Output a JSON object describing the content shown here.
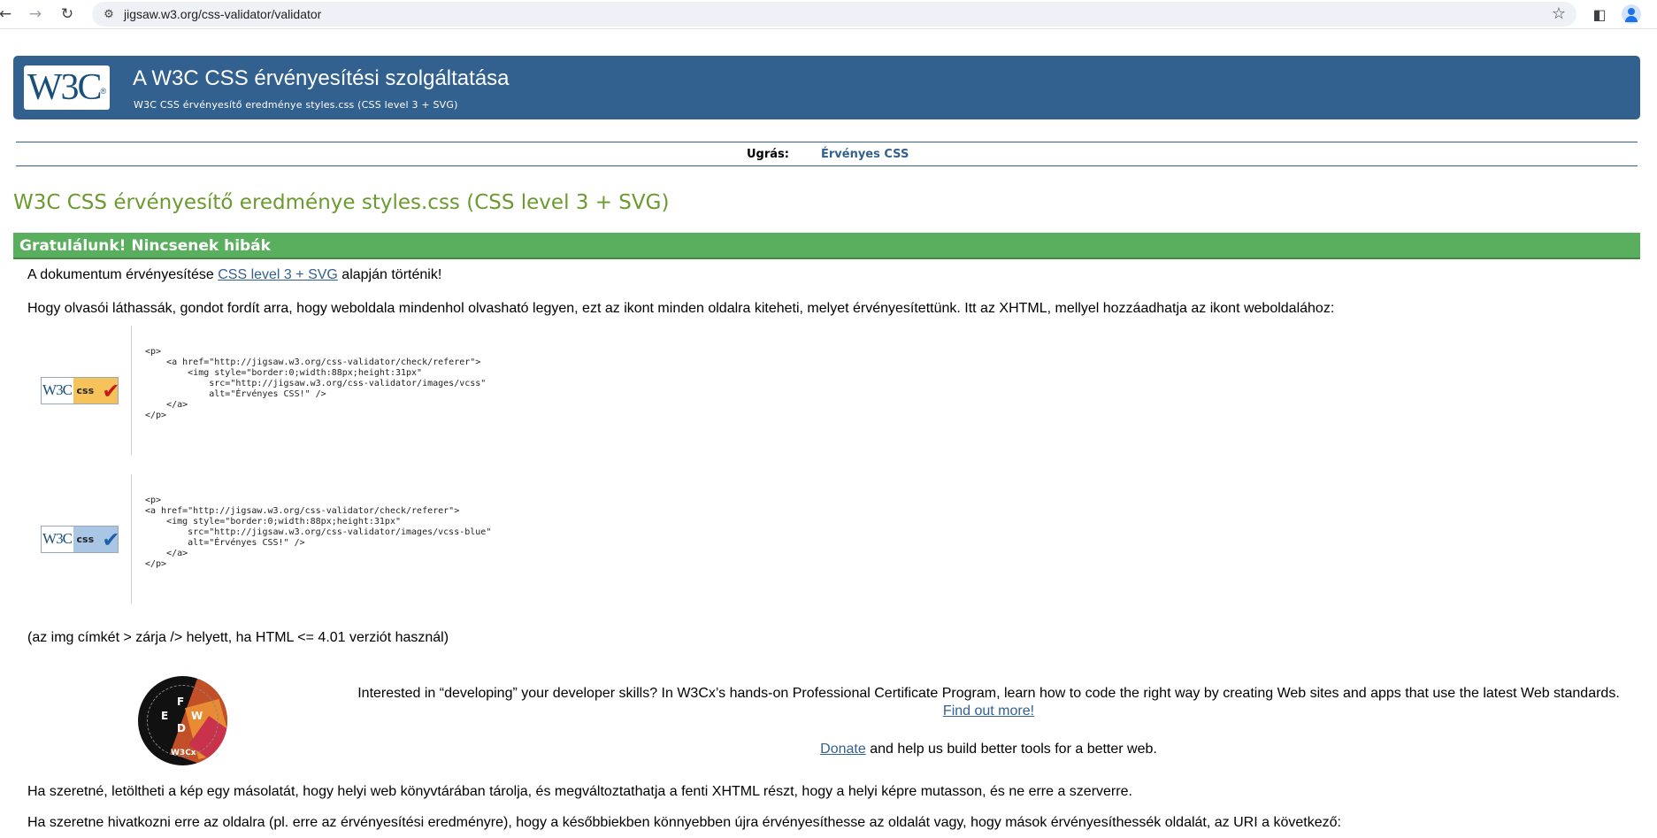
{
  "browser": {
    "url": "jigsaw.w3.org/css-validator/validator"
  },
  "banner": {
    "logo_text": "W3C",
    "title": "A W3C CSS érvényesítési szolgáltatása",
    "subtitle": "W3C CSS érvényesítő eredménye styles.css (CSS level 3 + SVG)"
  },
  "jump": {
    "label": "Ugrás:",
    "link": "Érvényes CSS"
  },
  "heading": "W3C CSS érvényesítő eredménye styles.css (CSS level 3 + SVG)",
  "congrats": "Gratulálunk! Nincsenek hibák",
  "validated": {
    "before": "A dokumentum érvényesítése ",
    "link": "CSS level 3 + SVG",
    "after": " alapján történik!"
  },
  "icon_intro": "Hogy olvasói láthassák, gondot fordít arra, hogy weboldala mindenhol olvasható legyen, ezt az ikont minden oldalra kiteheti, melyet érvényesítettünk. Itt az XHTML, mellyel hozzáadhatja az ikont weboldalához:",
  "badges": [
    {
      "w3c": "W3C",
      "css": "css",
      "check": "✔",
      "check_color": "#c41a1a",
      "css_bg": "#f6c35a",
      "code": "<p>\n    <a href=\"http://jigsaw.w3.org/css-validator/check/referer\">\n        <img style=\"border:0;width:88px;height:31px\"\n            src=\"http://jigsaw.w3.org/css-validator/images/vcss\"\n            alt=\"Érvényes CSS!\" />\n    </a>\n</p>"
    },
    {
      "w3c": "W3C",
      "css": "css",
      "check": "✔",
      "check_color": "#1f5fa8",
      "css_bg": "#a9c6e4",
      "code": "<p>\n<a href=\"http://jigsaw.w3.org/css-validator/check/referer\">\n    <img style=\"border:0;width:88px;height:31px\"\n        src=\"http://jigsaw.w3.org/css-validator/images/vcss-blue\"\n        alt=\"Érvényes CSS!\" />\n    </a>\n</p>"
    }
  ],
  "img_note": "(az img címkét > zárja /> helyett, ha HTML <= 4.01 verziót használ)",
  "promo": {
    "logo_caption": "W3Cx",
    "text": "Interested in “developing” your developer skills? In W3Cx’s hands-on Professional Certificate Program, learn how to code the right way by creating Web sites and apps that use the latest Web standards.",
    "link": "Find out more!"
  },
  "donate": {
    "link": "Donate",
    "text": " and help us build better tools for a better web."
  },
  "download_note": "Ha szeretné, letöltheti a kép egy másolatát, hogy helyi web könyvtárában tárolja, és megváltoztathatja a fenti XHTML részt, hogy a helyi képre mutasson, és ne erre a szerverre.",
  "refer_note": "Ha szeretne hivatkozni erre az oldalra (pl. erre az érvényesítési eredményre), hogy a későbbiekben könnyebben újra érvényesíthesse az oldalát vagy, hogy mások érvényesíthessék oldalát, az URI a következő:"
}
